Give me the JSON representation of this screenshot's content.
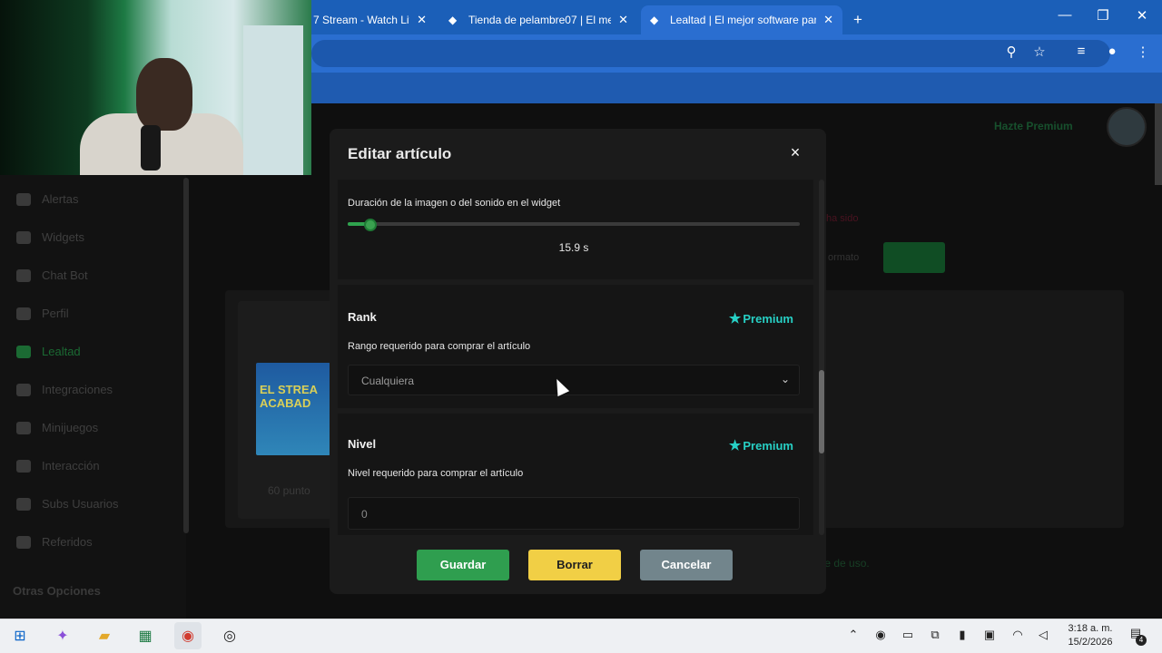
{
  "browser": {
    "tabs": [
      {
        "label": "7 Stream - Watch Liv"
      },
      {
        "label": "Tienda de pelambre07 | El mejo"
      },
      {
        "label": "Lealtad | El mejor software para",
        "active": true
      }
    ],
    "new_tab_symbol": "+",
    "toolbar_icons": [
      "zoom-icon",
      "star-icon",
      "media-icon",
      "profile-icon",
      "menu-icon"
    ]
  },
  "site": {
    "header_premium": "Hazte Premium",
    "sidebar": {
      "items": [
        {
          "label": "Alertas",
          "icon": "alert-icon"
        },
        {
          "label": "Widgets",
          "icon": "widgets-icon"
        },
        {
          "label": "Chat Bot",
          "icon": "chatbot-icon"
        },
        {
          "label": "Perfil",
          "icon": "profile-icon"
        },
        {
          "label": "Lealtad",
          "icon": "trophy-icon",
          "active": true
        },
        {
          "label": "Integraciones",
          "icon": "integrations-icon"
        },
        {
          "label": "Minijuegos",
          "icon": "games-icon"
        },
        {
          "label": "Interacción",
          "icon": "music-icon"
        },
        {
          "label": "Subs Usuarios",
          "icon": "subs-icon"
        },
        {
          "label": "Referidos",
          "icon": "referrals-icon"
        }
      ],
      "other_options": "Otras Opciones"
    },
    "product_image_text": "EL STREA ACABAD",
    "points_label": "60 punto",
    "error_text": "ha sido",
    "faded_text": "ormato",
    "footer_text": "te de uso."
  },
  "modal": {
    "title": "Editar artículo",
    "close_symbol": "×",
    "duration": {
      "label": "Duración de la imagen o del sonido en el widget",
      "value_text": "15.9 s",
      "slider_fraction": 0.05
    },
    "rank": {
      "heading": "Rank",
      "premium_label": "Premium",
      "description": "Rango requerido para comprar el artículo",
      "selected": "Cualquiera"
    },
    "level": {
      "heading": "Nivel",
      "premium_label": "Premium",
      "description": "Nivel requerido para comprar el artículo",
      "value": "0"
    },
    "buttons": {
      "save": "Guardar",
      "delete": "Borrar",
      "cancel": "Cancelar"
    }
  },
  "taskbar": {
    "apps": [
      "windows-start-icon",
      "copilot-icon",
      "file-explorer-icon",
      "excel-icon",
      "chrome-icon",
      "obs-icon"
    ],
    "time": "3:18 a. m.",
    "date": "15/2/2026",
    "notification_count": "4"
  },
  "colors": {
    "accent_green": "#2f9e4f",
    "premium_teal": "#27d0c5",
    "delete_yellow": "#f1cf45",
    "cancel_gray": "#72858c",
    "browser_blue": "#1b5fb8"
  }
}
